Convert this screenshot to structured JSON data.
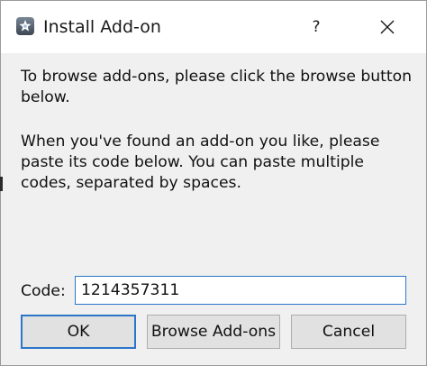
{
  "window": {
    "title": "Install Add-on",
    "help_label": "?",
    "close_icon": "close-icon",
    "app_icon": "anki-star-icon"
  },
  "content": {
    "paragraph_1": "To browse add-ons, please click the browse button below.",
    "paragraph_2": "When you've found an add-on you like, please paste its code below. You can paste multiple codes, separated by spaces."
  },
  "code_field": {
    "label": "Code:",
    "value": "1214357311"
  },
  "buttons": {
    "ok": "OK",
    "browse": "Browse Add-ons",
    "cancel": "Cancel"
  },
  "colors": {
    "accent": "#2b76c8",
    "button_face": "#e1e1e1",
    "dialog_bg": "#f0f0f0",
    "titlebar_bg": "#ffffff"
  }
}
